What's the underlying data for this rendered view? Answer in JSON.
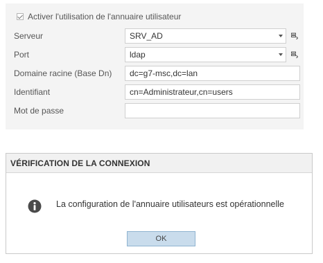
{
  "settings": {
    "enable_label": "Activer l'utilisation de l'annuaire utilisateur",
    "fields": {
      "server": {
        "label": "Serveur",
        "value": "SRV_AD"
      },
      "port": {
        "label": "Port",
        "value": "ldap"
      },
      "base_dn": {
        "label": "Domaine racine (Base Dn)",
        "value": "dc=g7-msc,dc=lan"
      },
      "identifier": {
        "label": "Identifiant",
        "value": "cn=Administrateur,cn=users"
      },
      "password": {
        "label": "Mot de passe",
        "value": ""
      }
    },
    "icons": {
      "checkbox": "checked-checkbox-icon",
      "dropdown": "chevron-down-icon",
      "side_button": "server-list-icon"
    }
  },
  "dialog": {
    "title": "VÉRIFICATION DE LA CONNEXION",
    "message": "La configuration de l'annuaire utilisateurs est opérationnelle",
    "ok_label": "OK",
    "icon": "info-icon"
  },
  "colors": {
    "panel_bg": "#f4f4f4",
    "ok_button_bg": "#c9dcec",
    "ok_button_border": "#8fb3d0",
    "info_icon": "#4a4a4a"
  }
}
